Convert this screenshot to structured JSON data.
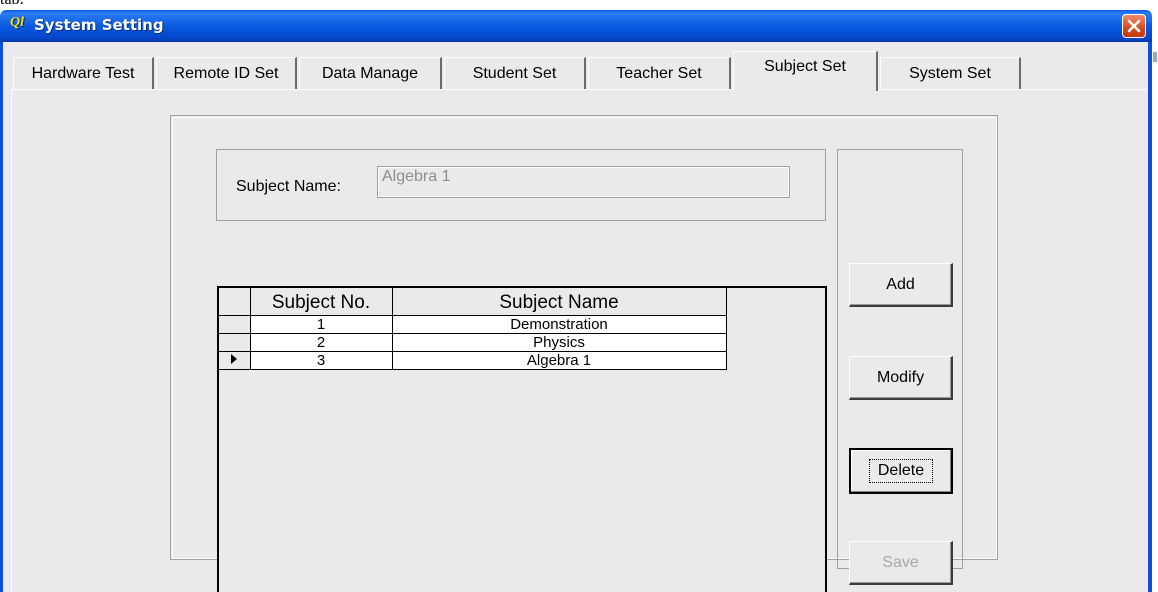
{
  "window": {
    "scrap_text": "tab:",
    "logo_text": "Ql",
    "title": "System Setting"
  },
  "tabs": [
    {
      "label": "Hardware Test",
      "active": false
    },
    {
      "label": "Remote ID Set",
      "active": false
    },
    {
      "label": "Data Manage",
      "active": false
    },
    {
      "label": "Student Set",
      "active": false
    },
    {
      "label": "Teacher Set",
      "active": false
    },
    {
      "label": "Subject Set",
      "active": true
    },
    {
      "label": "System Set",
      "active": false
    }
  ],
  "form": {
    "subject_name_label": "Subject Name:",
    "subject_name_value": "Algebra 1"
  },
  "buttons": {
    "add": "Add",
    "modify": "Modify",
    "delete": "Delete",
    "save": "Save"
  },
  "grid": {
    "columns": [
      "Subject No.",
      "Subject Name"
    ],
    "rows": [
      {
        "no": "1",
        "name": "Demonstration",
        "current": false
      },
      {
        "no": "2",
        "name": "Physics",
        "current": false
      },
      {
        "no": "3",
        "name": "Algebra 1",
        "current": true
      }
    ]
  },
  "colors": {
    "titlebar": "#0a5ae0",
    "client_bg": "#ece9ec",
    "close_button": "#d84a20",
    "disabled_text": "#a8a8a8"
  }
}
